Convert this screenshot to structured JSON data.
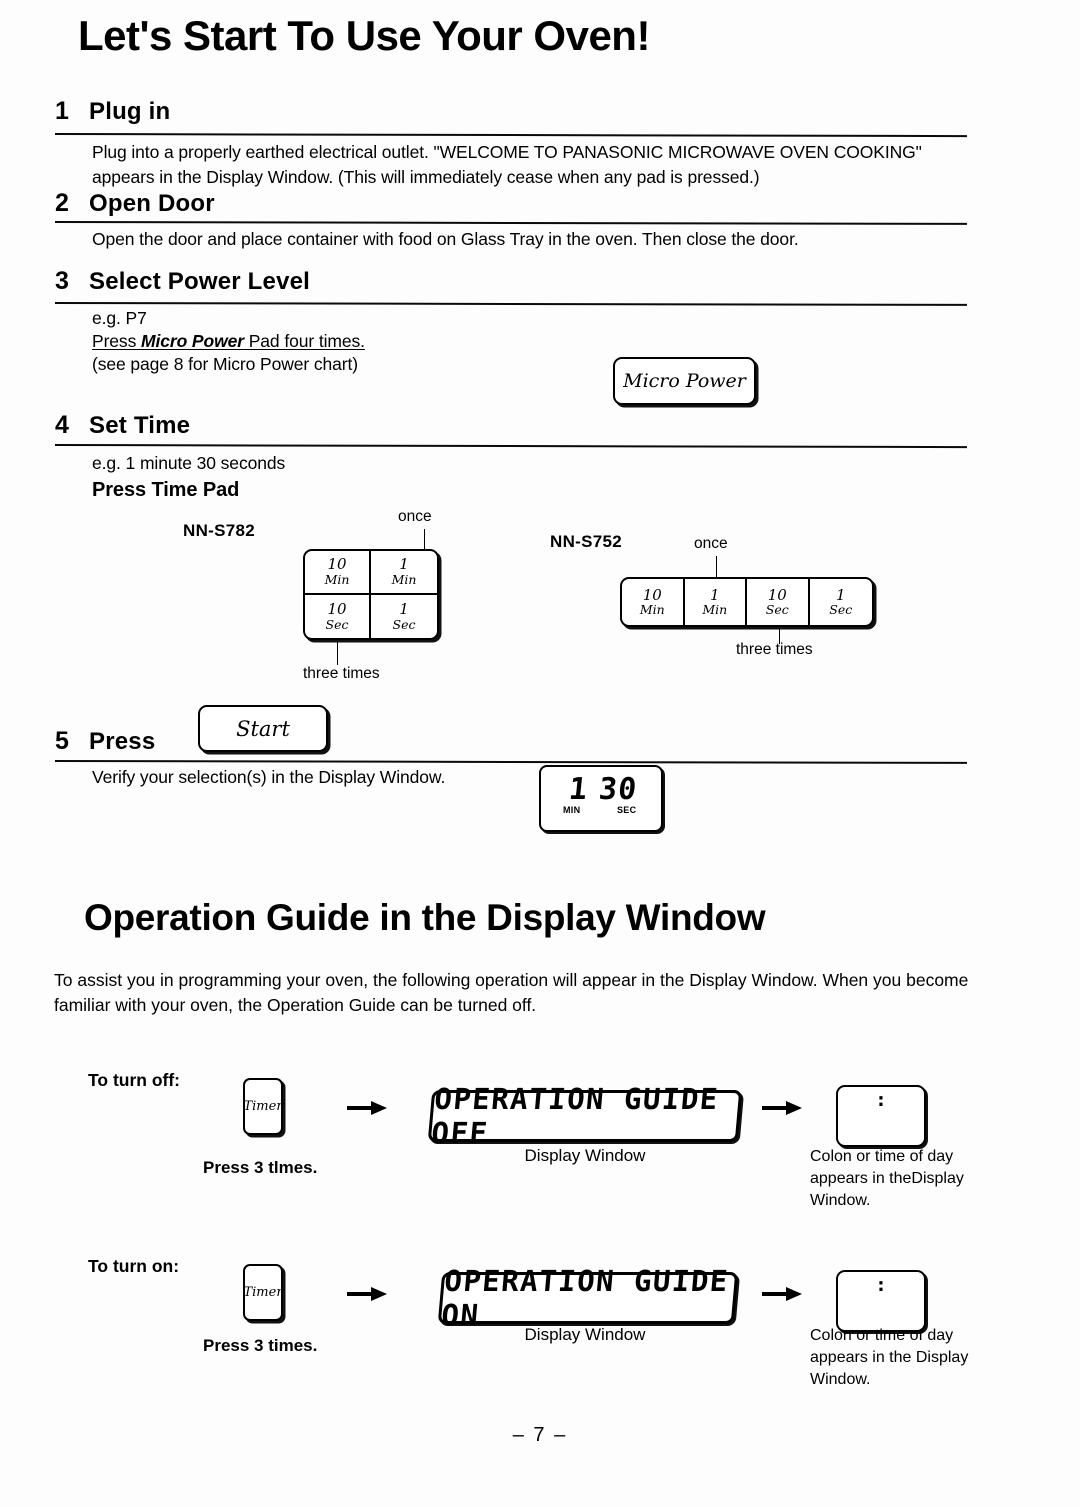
{
  "document": {
    "title": "Let's Start To Use Your Oven!",
    "page_number": "– 7 –"
  },
  "steps": [
    {
      "number": "1",
      "title": "Plug in",
      "body": "Plug into a properly earthed electrical outlet. \"WELCOME TO PANASONIC MICROWAVE OVEN COOKING\" appears in the Display Window. (This will immediately cease when any pad is pressed.)"
    },
    {
      "number": "2",
      "title": "Open Door",
      "body": "Open the door and place container with food on Glass Tray in the oven. Then close the door."
    },
    {
      "number": "3",
      "title": "Select Power Level",
      "example": "e.g. P7",
      "instruction_prefix": "Press ",
      "instruction_emphasis": "Micro Power",
      "instruction_suffix": " Pad four times.",
      "reference": "(see page 8 for Micro Power chart)",
      "pad_label": "Micro Power"
    },
    {
      "number": "4",
      "title": "Set Time",
      "example": "e.g. 1 minute 30 seconds",
      "instruction": "Press Time Pad"
    },
    {
      "number": "5",
      "title": "Press",
      "pad_label": "Start",
      "body": "Verify your selection(s) in the Display Window."
    }
  ],
  "time_pads": {
    "model_a": {
      "model": "NN-S782",
      "keys": [
        {
          "num": "10",
          "unit": "Min"
        },
        {
          "num": "1",
          "unit": "Min"
        },
        {
          "num": "10",
          "unit": "Sec"
        },
        {
          "num": "1",
          "unit": "Sec"
        }
      ],
      "callout_top": "once",
      "callout_bottom": "three times"
    },
    "model_b": {
      "model": "NN-S752",
      "keys": [
        {
          "num": "10",
          "unit": "Min"
        },
        {
          "num": "1",
          "unit": "Min"
        },
        {
          "num": "10",
          "unit": "Sec"
        },
        {
          "num": "1",
          "unit": "Sec"
        }
      ],
      "callout_top": "once",
      "callout_bottom": "three times"
    }
  },
  "readout": {
    "minutes": "1",
    "seconds": "30",
    "min_label": "MIN",
    "sec_label": "SEC"
  },
  "operation_guide": {
    "title": "Operation Guide in the Display Window",
    "intro": "To assist you in programming your oven, the following operation will appear in the Display Window. When you become familiar with your oven, the Operation Guide can be turned off.",
    "rows": [
      {
        "label": "To turn off:",
        "pad_label": "Timer",
        "press_note": "Press 3 tlmes.",
        "display_text": "OPERATION GUIDE OFF",
        "display_caption": "Display Window",
        "colon_glyph": ":",
        "result_note": "Colon or time of day appears in theDisplay Window."
      },
      {
        "label": "To turn on:",
        "pad_label": "Timer",
        "press_note": "Press 3 times.",
        "display_text": "OPERATION GUIDE ON",
        "display_caption": "Display Window",
        "colon_glyph": ":",
        "result_note": "Colon or time of day appears in the Display Window."
      }
    ]
  }
}
